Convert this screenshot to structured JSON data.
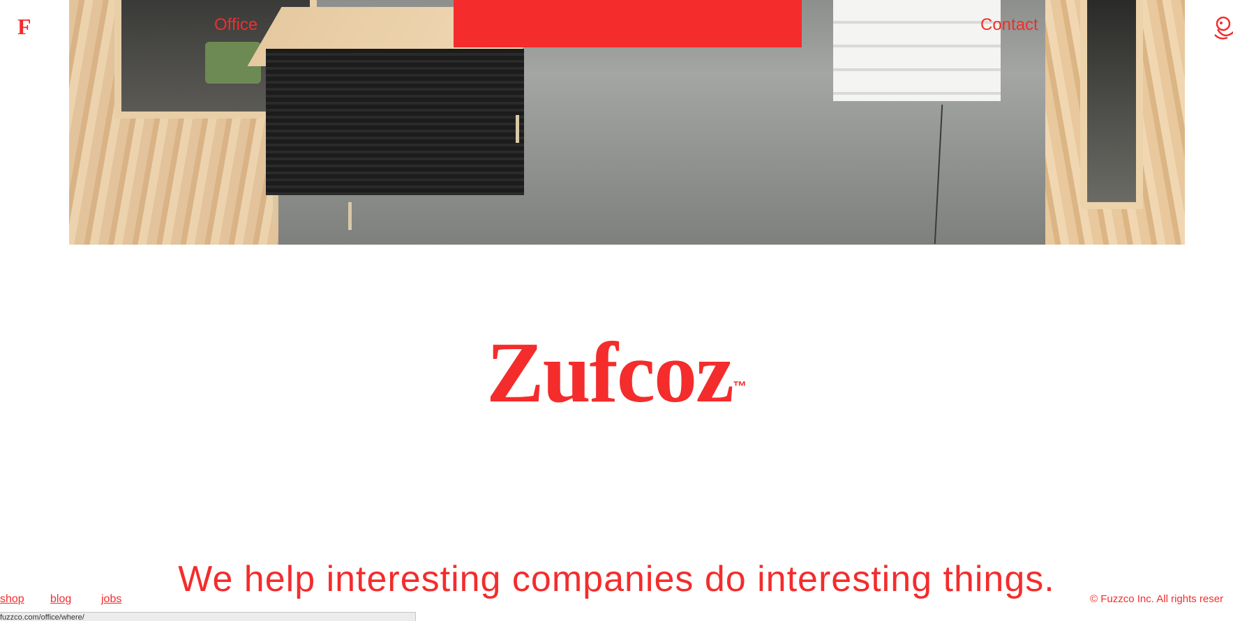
{
  "nav": {
    "logo": "F",
    "office": "Office",
    "contact": "Contact"
  },
  "brand": {
    "name": "Zufcoz",
    "tm": "™"
  },
  "tagline": "We help interesting companies do interesting things.",
  "footer": {
    "shop": "shop",
    "blog": "blog",
    "jobs": "jobs",
    "copyright": "© Fuzzco Inc. All rights reser"
  },
  "status_bar": "fuzzco.com/office/where/",
  "colors": {
    "accent": "#f42c2c"
  },
  "icons": {
    "mascot": "mascot-icon"
  }
}
